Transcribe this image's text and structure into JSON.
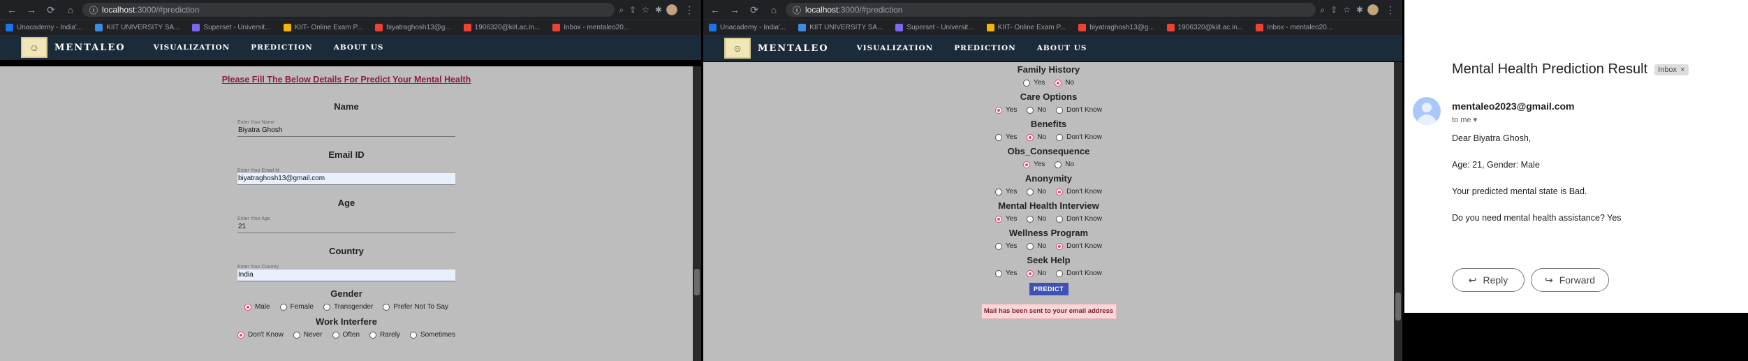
{
  "browser": {
    "url_host": "localhost",
    "url_path": ":3000/#prediction",
    "bookmarks": [
      "Unacademy - India'...",
      "KIIT UNIVERSITY SA...",
      "Superset - Universit...",
      "KIIT- Online Exam P...",
      "biyatraghosh13@g...",
      "1906320@kiit.ac.in...",
      "Inbox - mentaleo20..."
    ]
  },
  "app": {
    "brand": "MENTALEO",
    "nav": [
      "VISUALIZATION",
      "PREDICTION",
      "ABOUT US"
    ]
  },
  "form": {
    "heading": "Please Fill The Below Details For Predict Your Mental Health",
    "name": {
      "title": "Name",
      "label": "Enter Your Name",
      "value": "Biyatra Ghosh"
    },
    "email": {
      "title": "Email ID",
      "label": "Enter Your Email Id",
      "value": "biyatraghosh13@gmail.com"
    },
    "age": {
      "title": "Age",
      "label": "Enter Your Age",
      "value": "21"
    },
    "country": {
      "title": "Country",
      "label": "Enter Your Country",
      "value": "India"
    },
    "gender": {
      "title": "Gender",
      "options": [
        "Male",
        "Female",
        "Transgender",
        "Prefer Not To Say"
      ],
      "selected": 0
    },
    "work_interfere": {
      "title": "Work Interfere",
      "options": [
        "Don't Know",
        "Never",
        "Often",
        "Rarely",
        "Sometimes"
      ],
      "selected": 0
    },
    "questions": [
      {
        "title": "Family History",
        "options": [
          "Yes",
          "No"
        ],
        "selected": 1
      },
      {
        "title": "Care Options",
        "options": [
          "Yes",
          "No",
          "Don't Know"
        ],
        "selected": 0
      },
      {
        "title": "Benefits",
        "options": [
          "Yes",
          "No",
          "Don't Know"
        ],
        "selected": 1
      },
      {
        "title": "Obs_Consequence",
        "options": [
          "Yes",
          "No"
        ],
        "selected": 0
      },
      {
        "title": "Anonymity",
        "options": [
          "Yes",
          "No",
          "Don't Know"
        ],
        "selected": 2
      },
      {
        "title": "Mental Health Interview",
        "options": [
          "Yes",
          "No",
          "Don't Know"
        ],
        "selected": 0
      },
      {
        "title": "Wellness Program",
        "options": [
          "Yes",
          "No",
          "Don't Know"
        ],
        "selected": 2
      },
      {
        "title": "Seek Help",
        "options": [
          "Yes",
          "No",
          "Don't Know"
        ],
        "selected": 1
      }
    ],
    "predict_label": "PREDICT",
    "alert": "Mail has been sent to your email address"
  },
  "email": {
    "subject": "Mental Health Prediction Result",
    "label_chip": "Inbox",
    "sender": "mentaleo2023@gmail.com",
    "to": "to me",
    "greeting": "Dear Biyatra Ghosh,",
    "line1": "Age: 21, Gender: Male",
    "line2": "Your predicted mental state is Bad.",
    "line3": "Do you need mental health assistance? Yes",
    "reply": "Reply",
    "forward": "Forward"
  }
}
